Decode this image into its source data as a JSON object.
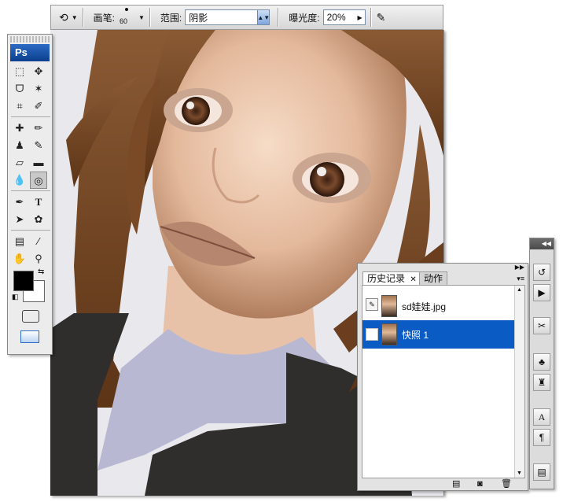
{
  "options_bar": {
    "brush_label": "画笔:",
    "brush_size": "60",
    "range_label": "范围:",
    "range_value": "阴影",
    "exposure_label": "曝光度:",
    "exposure_value": "20%"
  },
  "toolbox": {
    "logo": "Ps",
    "text_tool": "T"
  },
  "history_panel": {
    "tabs": [
      "历史记录",
      "动作"
    ],
    "items": [
      {
        "label": "sd娃娃.jpg"
      },
      {
        "label": "快照 1",
        "selected": true
      }
    ]
  },
  "dock": {
    "character_icon": "A",
    "paragraph_icon": "¶"
  },
  "colors": {
    "selection": "#0a5bc4",
    "foreground": "#000000",
    "background": "#ffffff"
  }
}
